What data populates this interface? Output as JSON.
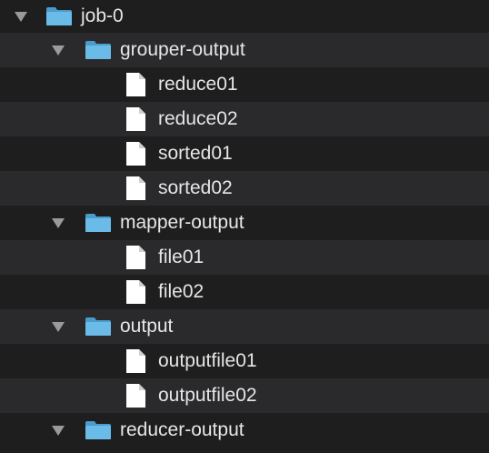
{
  "colors": {
    "background": "#1e1e1e",
    "stripe": "#2a2a2d",
    "text": "#e6e6e6",
    "folder": "#5fb0e0",
    "file": "#ffffff"
  },
  "tree": {
    "root": {
      "label": "job-0",
      "icon": "folder-icon",
      "expanded": true
    },
    "grouper": {
      "label": "grouper-output",
      "icon": "folder-icon",
      "expanded": true,
      "files": [
        "reduce01",
        "reduce02",
        "sorted01",
        "sorted02"
      ]
    },
    "mapper": {
      "label": "mapper-output",
      "icon": "folder-icon",
      "expanded": true,
      "files": [
        "file01",
        "file02"
      ]
    },
    "output": {
      "label": "output",
      "icon": "folder-icon",
      "expanded": true,
      "files": [
        "outputfile01",
        "outputfile02"
      ]
    },
    "reducer": {
      "label": "reducer-output",
      "icon": "folder-icon",
      "expanded": true,
      "files": []
    }
  }
}
